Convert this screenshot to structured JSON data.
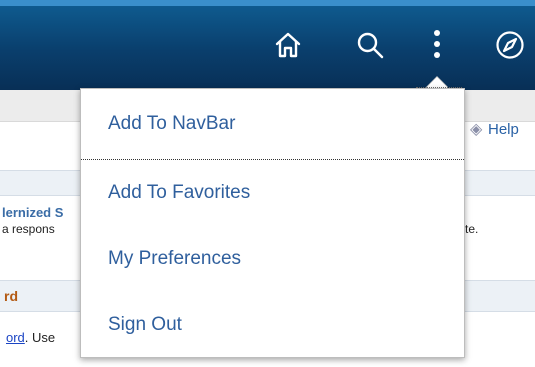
{
  "header": {
    "icons": [
      "home-icon",
      "search-icon",
      "more-vertical-icon",
      "compass-icon"
    ],
    "bar_color": "#0a3f6d"
  },
  "page": {
    "help_label": "Help",
    "section_title_fragment": "lernized S",
    "section_text_fragment": "a respons",
    "section_text_tail": "te.",
    "orange_heading_fragment": "rd",
    "link_fragment": "ord",
    "link_suffix": ". Use"
  },
  "actions_menu": {
    "items": [
      {
        "label": "Add To NavBar"
      },
      {
        "label": "Add To Favorites"
      },
      {
        "label": "My Preferences"
      },
      {
        "label": "Sign Out"
      }
    ],
    "text_color": "#2f5f9d"
  }
}
